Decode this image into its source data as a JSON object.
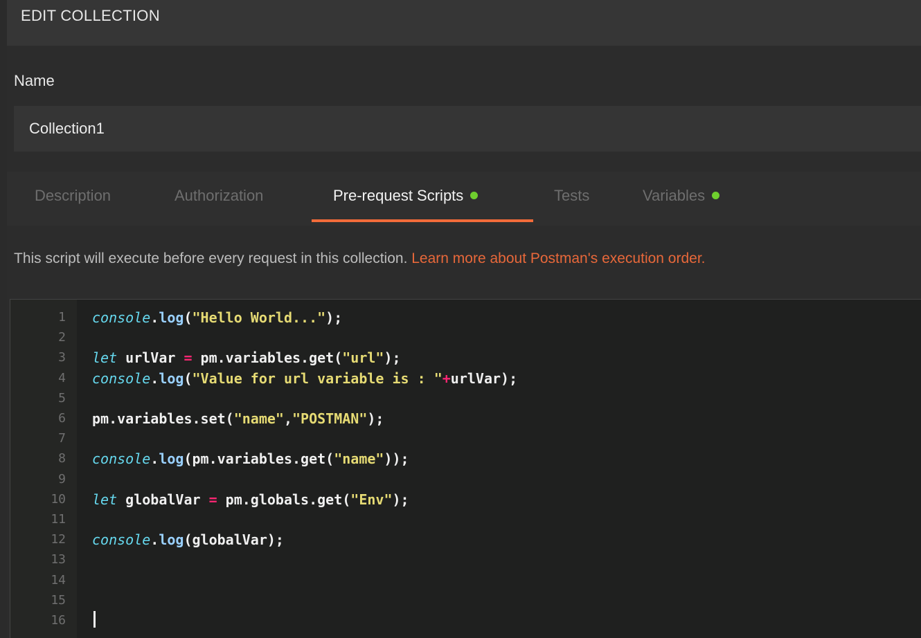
{
  "header": {
    "title": "EDIT COLLECTION"
  },
  "name": {
    "label": "Name",
    "value": "Collection1"
  },
  "tabs": [
    {
      "label": "Description",
      "active": false,
      "dot": false
    },
    {
      "label": "Authorization",
      "active": false,
      "dot": false
    },
    {
      "label": "Pre-request Scripts",
      "active": true,
      "dot": true
    },
    {
      "label": "Tests",
      "active": false,
      "dot": false
    },
    {
      "label": "Variables",
      "active": false,
      "dot": true
    }
  ],
  "info": {
    "text": "This script will execute before every request in this collection. ",
    "link": "Learn more about Postman's execution order."
  },
  "editor": {
    "line_numbers": [
      "1",
      "2",
      "3",
      "4",
      "5",
      "6",
      "7",
      "8",
      "9",
      "10",
      "11",
      "12",
      "13",
      "14",
      "15",
      "16"
    ],
    "lines": [
      "console.log(\"Hello World...\");",
      "",
      "let urlVar = pm.variables.get(\"url\");",
      "console.log(\"Value for url variable is : \"+urlVar);",
      "",
      "pm.variables.set(\"name\",\"POSTMAN\");",
      "",
      "console.log(pm.variables.get(\"name\"));",
      "",
      "let globalVar = pm.globals.get(\"Env\");",
      "",
      "console.log(globalVar);",
      "",
      "",
      "",
      ""
    ]
  },
  "colors": {
    "accent": "#f26b3a",
    "status_dot": "#6fcf2e",
    "link": "#e8683a"
  }
}
